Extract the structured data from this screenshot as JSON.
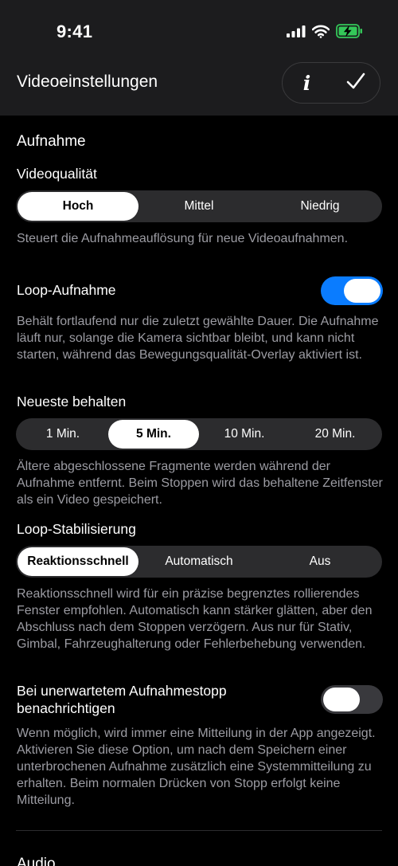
{
  "status_bar": {
    "time": "9:41",
    "icons": [
      "cellular-signal-icon",
      "wifi-icon",
      "battery-charging-icon"
    ],
    "battery_color": "#34c759"
  },
  "nav": {
    "title": "Videoeinstellungen",
    "info_icon": "info-icon",
    "done_icon": "checkmark-icon"
  },
  "sections": {
    "recording": {
      "title": "Aufnahme",
      "video_quality": {
        "label": "Videoqualität",
        "options": [
          "Hoch",
          "Mittel",
          "Niedrig"
        ],
        "selected": "Hoch",
        "description": "Steuert die Aufnahmeauflösung für neue Videoaufnahmen."
      },
      "loop_recording": {
        "label": "Loop-Aufnahme",
        "enabled": true,
        "description": "Behält fortlaufend nur die zuletzt gewählte Dauer. Die Aufnahme läuft nur, solange die Kamera sichtbar bleibt, und kann nicht starten, während das Bewegungsqualität-Overlay aktiviert ist."
      },
      "keep_latest": {
        "label": "Neueste behalten",
        "options": [
          "1 Min.",
          "5 Min.",
          "10 Min.",
          "20 Min."
        ],
        "selected": "5 Min.",
        "description": "Ältere abgeschlossene Fragmente werden während der Aufnahme entfernt. Beim Stoppen wird das behaltene Zeitfenster als ein Video gespeichert."
      },
      "loop_stabilization": {
        "label": "Loop-Stabilisierung",
        "options": [
          "Reaktionsschnell",
          "Automatisch",
          "Aus"
        ],
        "selected": "Reaktionsschnell",
        "description": "Reaktionsschnell wird für ein präzise begrenztes rollierendes Fenster empfohlen. Automatisch kann stärker glätten, aber den Abschluss nach dem Stoppen verzögern. Aus nur für Stativ, Gimbal, Fahrzeughalterung oder Fehlerbehebung verwenden."
      },
      "notify_unexpected_stop": {
        "label": "Bei unerwartetem Aufnahmestopp benachrichtigen",
        "enabled": false,
        "description": "Wenn möglich, wird immer eine Mitteilung in der App angezeigt. Aktivieren Sie diese Option, um nach dem Speichern einer unterbrochenen Aufnahme zusätzlich eine Systemmitteilung zu erhalten. Beim normalen Drücken von Stopp erfolgt keine Mitteilung."
      }
    },
    "audio": {
      "title": "Audio"
    }
  },
  "colors": {
    "accent": "#0a7cff",
    "header_bg": "#1c1c1e",
    "segment_bg": "#2c2c2e",
    "secondary_text": "#9c9ca3"
  }
}
